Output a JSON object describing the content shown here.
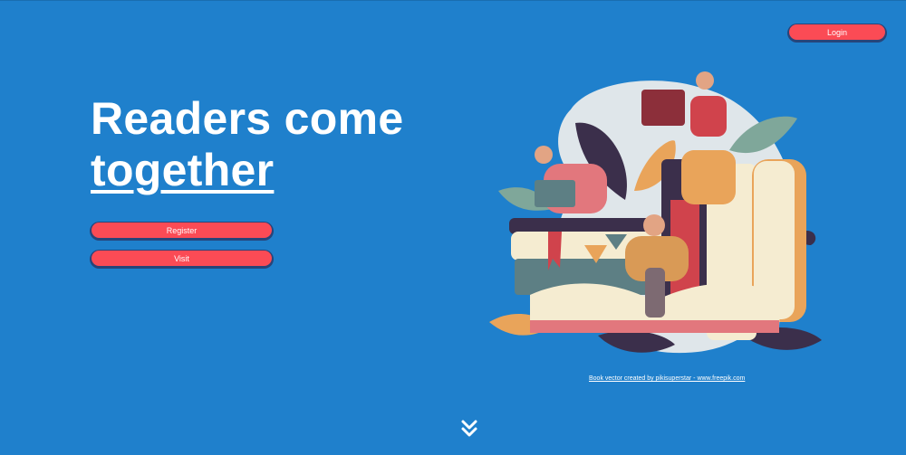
{
  "header": {
    "login_label": "Login"
  },
  "hero": {
    "title_line1": "Readers come",
    "title_line2": "together",
    "register_label": "Register",
    "visit_label": "Visit"
  },
  "illustration": {
    "credit_text": "Book vector created by pikisuperstar - www.freepik.com"
  },
  "footer": {
    "scroll_icon": "double-chevron-down-icon"
  },
  "colors": {
    "background": "#1f80cc",
    "button": "#fb4b55",
    "text": "#ffffff"
  }
}
